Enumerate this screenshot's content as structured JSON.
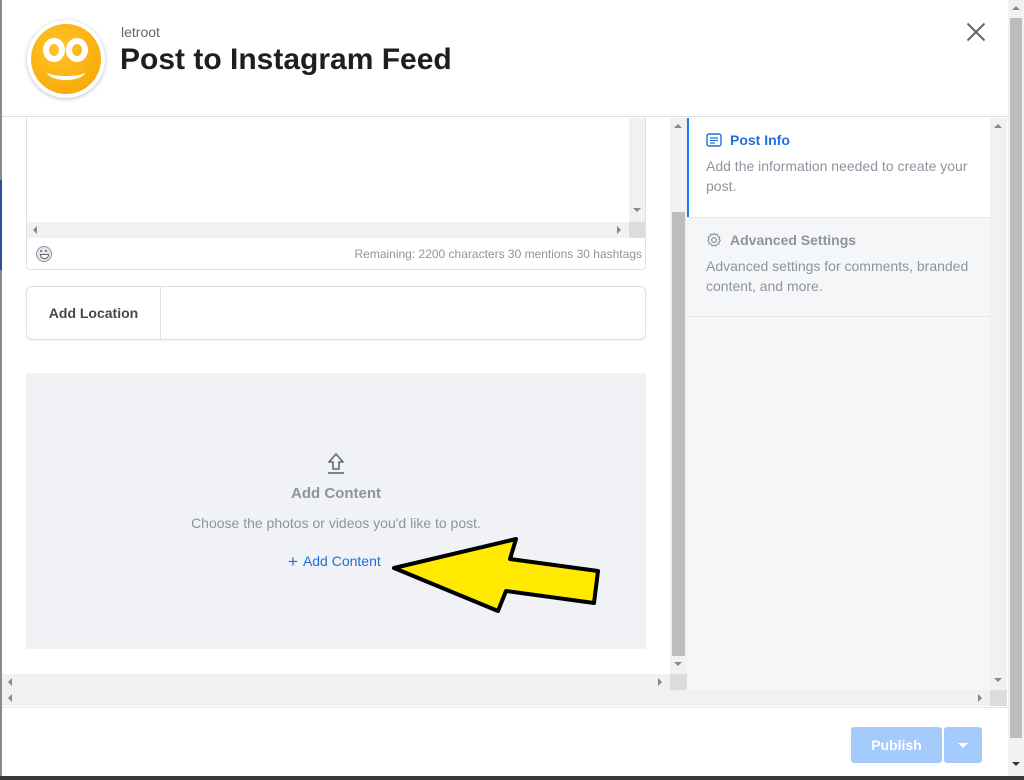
{
  "header": {
    "owner_name": "letroot",
    "title": "Post to Instagram Feed",
    "close_icon": "close-icon"
  },
  "caption": {
    "value": "",
    "remaining_text": "Remaining: 2200 characters 30 mentions 30 hashtags",
    "emoji_icon": "emoji-smile-icon"
  },
  "location": {
    "label": "Add Location",
    "value": ""
  },
  "content": {
    "icon": "upload-icon",
    "title": "Add Content",
    "description": "Choose the photos or videos you'd like to post.",
    "add_link_label": "Add Content",
    "add_link_icon": "plus-icon",
    "annotation": "yellow-arrow-pointer"
  },
  "steps": [
    {
      "title": "Post Info",
      "description": "Add the information needed to create your post.",
      "icon": "document-lines-icon",
      "active": true
    },
    {
      "title": "Advanced Settings",
      "description": "Advanced settings for comments, branded content, and more.",
      "icon": "gear-icon",
      "active": false
    }
  ],
  "footer": {
    "publish_label": "Publish",
    "publish_menu_icon": "caret-down-icon"
  },
  "colors": {
    "accent": "#216fdb",
    "active_border": "#1877f2",
    "publish_disabled": "#a4cbfb",
    "annotation_arrow": "#ffea00"
  }
}
